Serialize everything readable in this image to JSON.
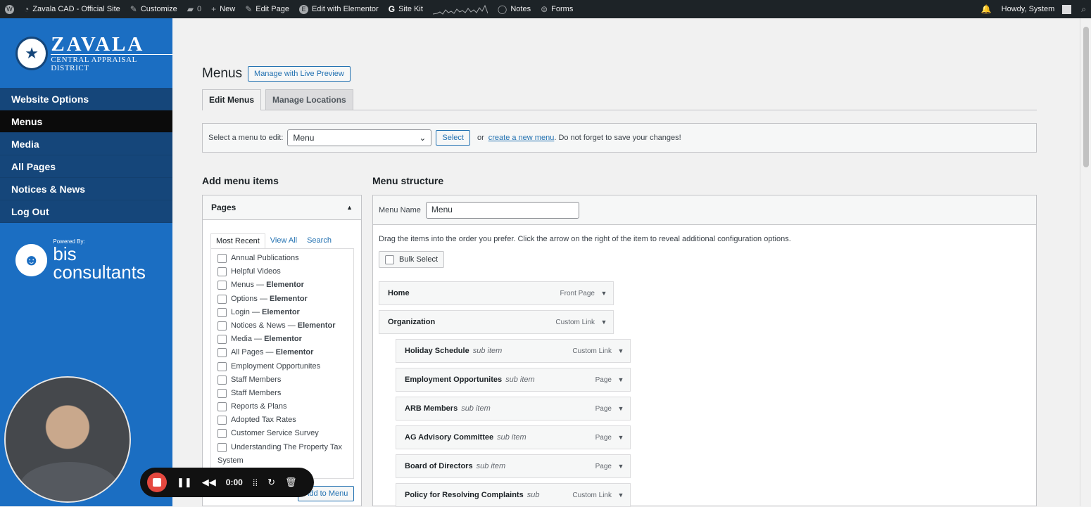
{
  "adminbar": {
    "site_name": "Zavala CAD - Official Site",
    "customize": "Customize",
    "comments_count": "0",
    "new": "New",
    "edit_page": "Edit Page",
    "edit_elementor": "Edit with Elementor",
    "site_kit": "Site Kit",
    "notes": "Notes",
    "forms": "Forms",
    "howdy": "Howdy, System"
  },
  "logo": {
    "name": "ZAVALA",
    "subtitle": "CENTRAL APPRAISAL DISTRICT"
  },
  "sidebar": {
    "items": [
      {
        "label": "Website Options"
      },
      {
        "label": "Menus"
      },
      {
        "label": "Media"
      },
      {
        "label": "All Pages"
      },
      {
        "label": "Notices & News"
      },
      {
        "label": "Log Out"
      }
    ],
    "powered_by": "Powered By:",
    "powered_brand": "bis consultants"
  },
  "page": {
    "title": "Menus",
    "live_preview": "Manage with Live Preview",
    "tabs": [
      {
        "label": "Edit Menus"
      },
      {
        "label": "Manage Locations"
      }
    ],
    "select_label": "Select a menu to edit:",
    "select_value": "Menu",
    "select_button": "Select",
    "or_text": "or",
    "create_link": "create a new menu",
    "save_hint": ". Do not forget to save your changes!"
  },
  "add_items": {
    "heading": "Add menu items",
    "pages_label": "Pages",
    "sub_tabs": [
      {
        "label": "Most Recent"
      },
      {
        "label": "View All"
      },
      {
        "label": "Search"
      }
    ],
    "pages": [
      {
        "label": "Annual Publications",
        "suffix": ""
      },
      {
        "label": "Helpful Videos",
        "suffix": ""
      },
      {
        "label": "Menus — ",
        "suffix": "Elementor"
      },
      {
        "label": "Options — ",
        "suffix": "Elementor"
      },
      {
        "label": "Login — ",
        "suffix": "Elementor"
      },
      {
        "label": "Notices & News — ",
        "suffix": "Elementor"
      },
      {
        "label": "Media — ",
        "suffix": "Elementor"
      },
      {
        "label": "All Pages — ",
        "suffix": "Elementor"
      },
      {
        "label": "Employment Opportunites",
        "suffix": ""
      },
      {
        "label": "Staff Members",
        "suffix": ""
      },
      {
        "label": "Staff Members",
        "suffix": ""
      },
      {
        "label": "Reports & Plans",
        "suffix": ""
      },
      {
        "label": "Adopted Tax Rates",
        "suffix": ""
      },
      {
        "label": "Customer Service Survey",
        "suffix": ""
      },
      {
        "label": "Understanding The Property Tax",
        "suffix": ""
      }
    ],
    "wrap_text": "System",
    "add_button": "Add to Menu"
  },
  "structure": {
    "heading": "Menu structure",
    "name_label": "Menu Name",
    "name_value": "Menu",
    "hint": "Drag the items into the order you prefer. Click the arrow on the right of the item to reveal additional configuration options.",
    "bulk_select": "Bulk Select",
    "items": [
      {
        "title": "Home",
        "sub": "",
        "type": "Front Page"
      },
      {
        "title": "Organization",
        "sub": "",
        "type": "Custom Link"
      },
      {
        "title": "Holiday Schedule",
        "sub": "sub item",
        "type": "Custom Link"
      },
      {
        "title": "Employment Opportunites",
        "sub": "sub item",
        "type": "Page"
      },
      {
        "title": "ARB Members",
        "sub": "sub item",
        "type": "Page"
      },
      {
        "title": "AG Advisory Committee",
        "sub": "sub item",
        "type": "Page"
      },
      {
        "title": "Board of Directors",
        "sub": "sub item",
        "type": "Page"
      },
      {
        "title": "Policy for Resolving Complaints",
        "sub": "sub",
        "type": "Custom Link"
      }
    ]
  },
  "recorder": {
    "time": "0:00"
  },
  "colors": {
    "brand": "#1b6ec2",
    "accent": "#2271b1",
    "record": "#e5483f"
  }
}
